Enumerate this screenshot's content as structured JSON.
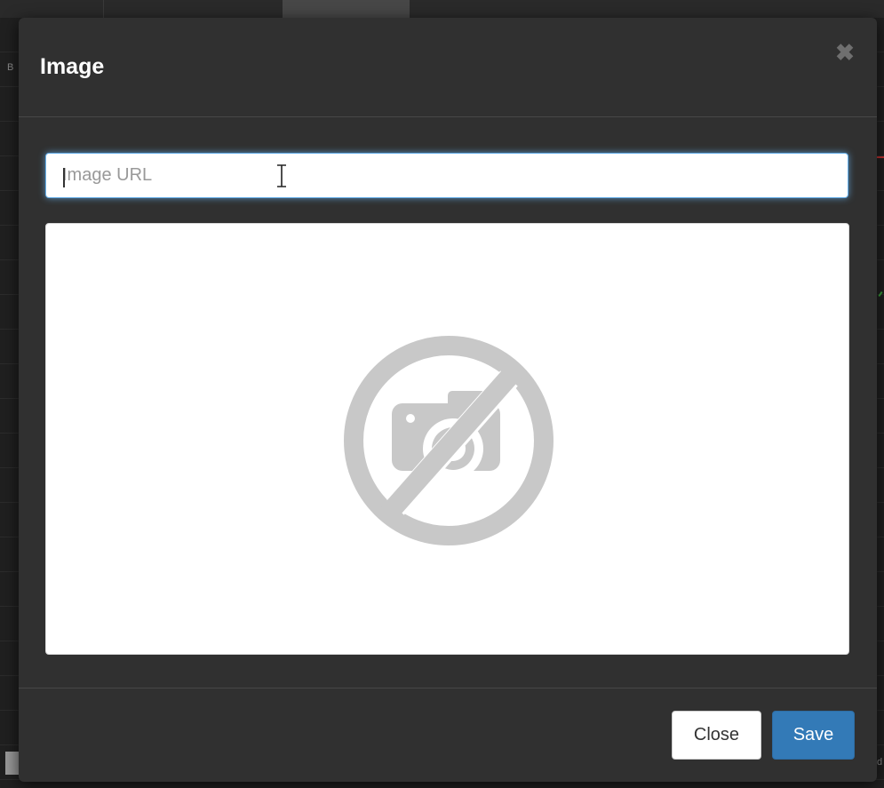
{
  "background": {
    "left_label": "B",
    "right_label": "d"
  },
  "dialog": {
    "title": "Image",
    "close_icon": "close-icon",
    "url_input": {
      "value": "",
      "placeholder": "Image URL"
    },
    "preview": {
      "icon": "no-image-icon"
    },
    "footer": {
      "close_label": "Close",
      "save_label": "Save"
    }
  },
  "colors": {
    "accent": "#337ab7",
    "focus_ring": "#66afe9",
    "dialog_bg": "#303030",
    "title_text": "#ffffff",
    "placeholder_icon": "#c8c8c8"
  }
}
